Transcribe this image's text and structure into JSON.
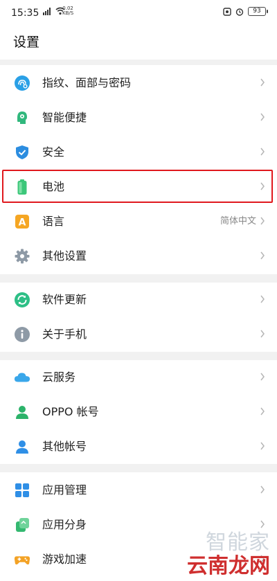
{
  "status": {
    "time": "15:35",
    "net_speed_value": "0.02",
    "net_speed_unit": "KB/S",
    "battery": "93"
  },
  "title": "设置",
  "groups": [
    {
      "items": [
        {
          "label": "指纹、面部与密码",
          "icon": "fingerprint-icon"
        },
        {
          "label": "智能便捷",
          "icon": "smart-assist-icon"
        },
        {
          "label": "安全",
          "icon": "shield-icon"
        },
        {
          "label": "电池",
          "icon": "battery-icon"
        },
        {
          "label": "语言",
          "icon": "language-icon",
          "value": "简体中文"
        },
        {
          "label": "其他设置",
          "icon": "gear-icon"
        }
      ]
    },
    {
      "items": [
        {
          "label": "软件更新",
          "icon": "update-icon"
        },
        {
          "label": "关于手机",
          "icon": "info-icon"
        }
      ]
    },
    {
      "items": [
        {
          "label": "云服务",
          "icon": "cloud-icon"
        },
        {
          "label": "OPPO 帐号",
          "icon": "user-account-icon"
        },
        {
          "label": "其他帐号",
          "icon": "other-account-icon"
        }
      ]
    },
    {
      "items": [
        {
          "label": "应用管理",
          "icon": "app-grid-icon"
        },
        {
          "label": "应用分身",
          "icon": "app-clone-icon"
        },
        {
          "label": "游戏加速",
          "icon": "gamepad-icon"
        }
      ]
    }
  ],
  "language_icon_letter": "A",
  "watermark": {
    "top": "智能家",
    "bottom": "云南龙网"
  },
  "colors": {
    "highlight": "#e0181d",
    "separator": "#f1f1f1",
    "chevron": "#b5b5b5"
  }
}
